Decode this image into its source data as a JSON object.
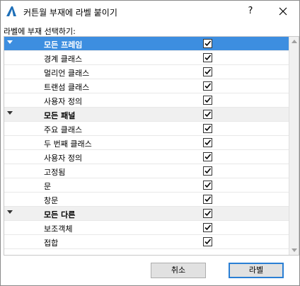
{
  "window": {
    "title": "커튼월 부재에 라벨 붙이기",
    "help_label": "?"
  },
  "subtitle": "라벨에 부재 선택하기:",
  "rows": [
    {
      "label": "모든 프레임",
      "group": true,
      "selected": true,
      "checked": true
    },
    {
      "label": "경계 클래스",
      "group": false,
      "selected": false,
      "checked": true
    },
    {
      "label": "멀리언 클래스",
      "group": false,
      "selected": false,
      "checked": true
    },
    {
      "label": "트랜섬 클래스",
      "group": false,
      "selected": false,
      "checked": true
    },
    {
      "label": "사용자 정의",
      "group": false,
      "selected": false,
      "checked": true
    },
    {
      "label": "모든 패널",
      "group": true,
      "selected": false,
      "checked": true
    },
    {
      "label": "주요 클래스",
      "group": false,
      "selected": false,
      "checked": true
    },
    {
      "label": "두 번째 클래스",
      "group": false,
      "selected": false,
      "checked": true
    },
    {
      "label": "사용자 정의",
      "group": false,
      "selected": false,
      "checked": true
    },
    {
      "label": "고정됨",
      "group": false,
      "selected": false,
      "checked": true
    },
    {
      "label": "문",
      "group": false,
      "selected": false,
      "checked": true
    },
    {
      "label": "창문",
      "group": false,
      "selected": false,
      "checked": true
    },
    {
      "label": "모든 다른",
      "group": true,
      "selected": false,
      "checked": true
    },
    {
      "label": "보조객체",
      "group": false,
      "selected": false,
      "checked": true
    },
    {
      "label": "접합",
      "group": false,
      "selected": false,
      "checked": true
    }
  ],
  "buttons": {
    "cancel": "취소",
    "ok": "라벨"
  },
  "colors": {
    "selection": "#3d8ee0",
    "group_bg": "#f0f0f0",
    "default_button_border": "#2a7fd4"
  }
}
